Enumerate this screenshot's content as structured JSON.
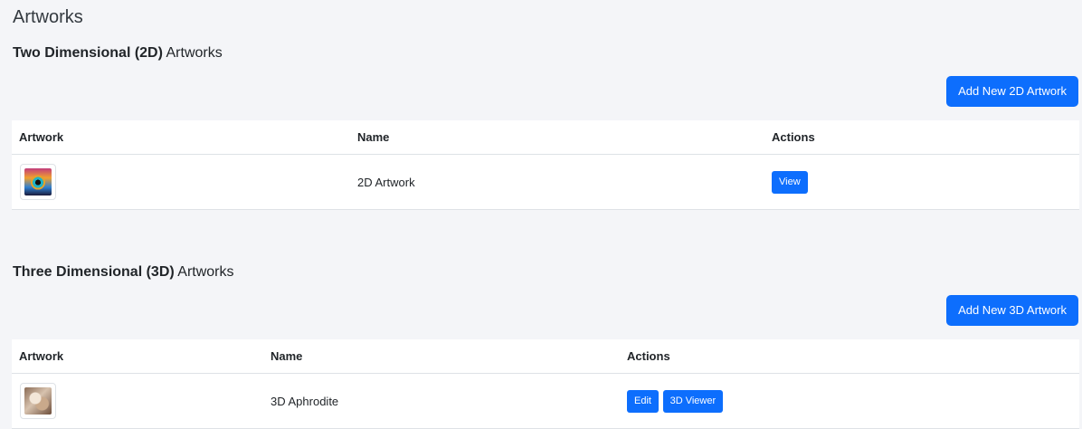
{
  "page": {
    "title": "Artworks"
  },
  "section_2d": {
    "title_bold": "Two Dimensional (2D)",
    "title_rest": " Artworks",
    "add_button": "Add New 2D Artwork",
    "columns": [
      "Artwork",
      "Name",
      "Actions"
    ],
    "rows": [
      {
        "thumbnail": "eye-artwork-thumbnail",
        "name": "2D Artwork",
        "actions": [
          "View"
        ]
      }
    ]
  },
  "section_3d": {
    "title_bold": "Three Dimensional (3D)",
    "title_rest": " Artworks",
    "add_button": "Add New 3D Artwork",
    "columns": [
      "Artwork",
      "Name",
      "Actions"
    ],
    "rows": [
      {
        "thumbnail": "aphrodite-thumbnail",
        "name": "3D Aphrodite",
        "actions": [
          "Edit",
          "3D Viewer"
        ]
      }
    ]
  },
  "colors": {
    "primary": "#0d6efd",
    "background": "#f4f5f8"
  }
}
